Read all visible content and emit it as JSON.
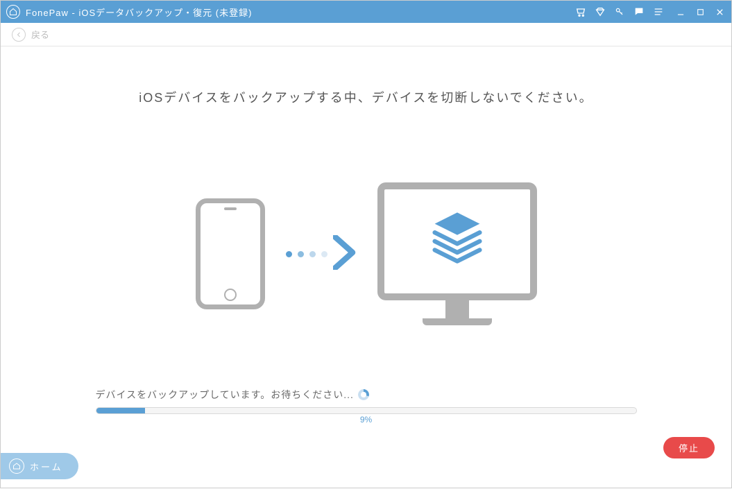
{
  "titlebar": {
    "title": "FonePaw - iOSデータバックアップ・復元 (未登録)"
  },
  "subheader": {
    "back_label": "戻る"
  },
  "headline": "iOSデバイスをバックアップする中、デバイスを切断しないでください。",
  "status_text": "デバイスをバックアップしています。お待ちください...",
  "progress": {
    "percent": 9,
    "label": "9%"
  },
  "stop_label": "停止",
  "home_label": "ホーム",
  "dots_colors": [
    "#5a9fd4",
    "#8cbde0",
    "#bcd7ec",
    "#dce9f4"
  ],
  "arrow_color": "#5a9fd4",
  "stack_colors": {
    "top": "#5a9fd4",
    "lines": "#5a9fd4"
  }
}
